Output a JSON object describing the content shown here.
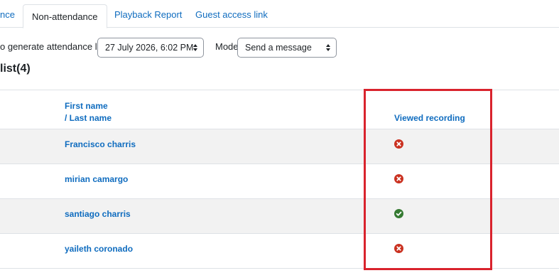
{
  "tabs": [
    {
      "label": "nce",
      "active": false
    },
    {
      "label": "Non-attendance",
      "active": true
    },
    {
      "label": "Playback Report",
      "active": false
    },
    {
      "label": "Guest access link",
      "active": false
    }
  ],
  "filters": {
    "date_label": "o generate attendance list",
    "date_value": "27 July 2026, 6:02 PM",
    "mode_label": "Mode",
    "mode_value": "Send a message"
  },
  "list_heading": "list(4)",
  "table": {
    "col_first_name": "First name",
    "col_last_name": "/ Last name",
    "col_viewed": "Viewed recording",
    "rows": [
      {
        "name": "Francisco charris",
        "viewed": false,
        "status_icon": "x-circle-icon"
      },
      {
        "name": "mirian camargo",
        "viewed": false,
        "status_icon": "x-circle-icon"
      },
      {
        "name": "santiago charris",
        "viewed": true,
        "status_icon": "check-circle-icon"
      },
      {
        "name": "yaileth coronado",
        "viewed": false,
        "status_icon": "x-circle-icon"
      }
    ]
  },
  "colors": {
    "link": "#0f6cbf",
    "viewed_no": "#ca3120",
    "viewed_yes": "#357a32",
    "highlight_border": "#d9232d"
  }
}
